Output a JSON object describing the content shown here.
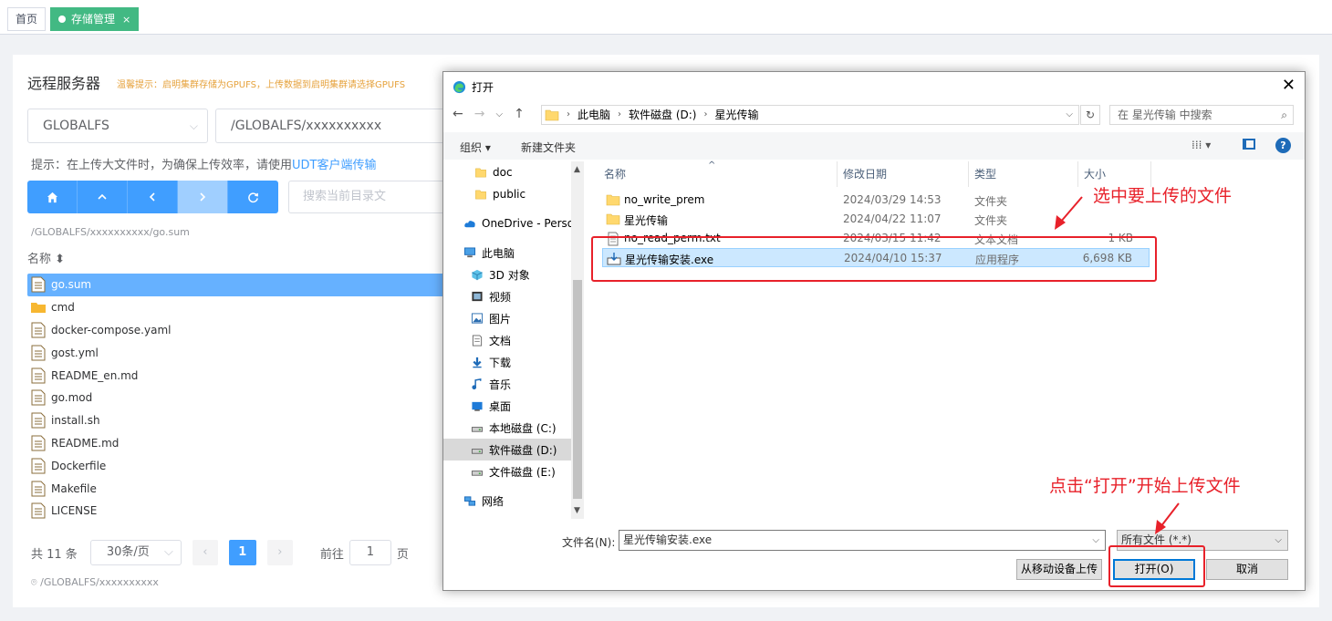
{
  "tabs": {
    "home": "首页",
    "storage": "存储管理",
    "close": "×"
  },
  "panel": {
    "title": "远程服务器",
    "warning": "温馨提示：启明集群存储为GPUFS，上传数据到启明集群请选择GPUFS",
    "storage_select": "GLOBALFS",
    "path_value": "/GLOBALFS/xxxxxxxxxx",
    "hint_prefix": "提示：在上传大文件时，为确保上传效率，请使用",
    "hint_link": "UDT客户端传输",
    "search_placeholder": "搜索当前目录文",
    "current_path": "/GLOBALFS/xxxxxxxxxx/go.sum",
    "column_name": "名称",
    "files": [
      {
        "name": "go.sum",
        "type": "file",
        "selected": true
      },
      {
        "name": "cmd",
        "type": "folder"
      },
      {
        "name": "docker-compose.yaml",
        "type": "file"
      },
      {
        "name": "gost.yml",
        "type": "file"
      },
      {
        "name": "README_en.md",
        "type": "file"
      },
      {
        "name": "go.mod",
        "type": "file"
      },
      {
        "name": "install.sh",
        "type": "file"
      },
      {
        "name": "README.md",
        "type": "file"
      },
      {
        "name": "Dockerfile",
        "type": "file"
      },
      {
        "name": "Makefile",
        "type": "file"
      },
      {
        "name": "LICENSE",
        "type": "file"
      }
    ],
    "pager": {
      "total": "共 11 条",
      "page_size": "30条/页",
      "current": "1",
      "goto_prefix": "前往",
      "goto_value": "1",
      "goto_suffix": "页"
    },
    "location": "/GLOBALFS/xxxxxxxxxx"
  },
  "dialog": {
    "title": "打开",
    "breadcrumb": [
      "此电脑",
      "软件磁盘 (D:)",
      "星光传输"
    ],
    "search_placeholder": "在 星光传输 中搜索",
    "organize": "组织 ▾",
    "new_folder": "新建文件夹",
    "view_icon": "⁞⁞⁞ ▾",
    "help": "?",
    "tree": [
      {
        "label": "doc",
        "icon": "folder-icon"
      },
      {
        "label": "public",
        "icon": "folder-icon"
      },
      {
        "label": "OneDrive - Perso",
        "icon": "cloud-icon"
      },
      {
        "label": "此电脑",
        "icon": "computer-icon"
      },
      {
        "label": "3D 对象",
        "icon": "cube-icon"
      },
      {
        "label": "视频",
        "icon": "video-icon"
      },
      {
        "label": "图片",
        "icon": "picture-icon"
      },
      {
        "label": "文档",
        "icon": "document-icon"
      },
      {
        "label": "下载",
        "icon": "download-icon"
      },
      {
        "label": "音乐",
        "icon": "music-icon"
      },
      {
        "label": "桌面",
        "icon": "desktop-icon"
      },
      {
        "label": "本地磁盘 (C:)",
        "icon": "drive-icon"
      },
      {
        "label": "软件磁盘 (D:)",
        "icon": "drive-icon",
        "selected": true
      },
      {
        "label": "文件磁盘 (E:)",
        "icon": "drive-icon"
      },
      {
        "label": "网络",
        "icon": "network-icon"
      }
    ],
    "columns": {
      "name": "名称",
      "date": "修改日期",
      "type": "类型",
      "size": "大小"
    },
    "files": [
      {
        "name": "no_write_prem",
        "date": "2024/03/29 14:53",
        "type": "文件夹",
        "size": "",
        "icon": "folder-icon"
      },
      {
        "name": "星光传输",
        "date": "2024/04/22 11:07",
        "type": "文件夹",
        "size": "",
        "icon": "folder-icon"
      },
      {
        "name": "no_read_perm.txt",
        "date": "2024/03/15 11:42",
        "type": "文本文档",
        "size": "1 KB",
        "icon": "text-file-icon"
      },
      {
        "name": "星光传输安装.exe",
        "date": "2024/04/10 15:37",
        "type": "应用程序",
        "size": "6,698 KB",
        "icon": "installer-icon",
        "selected": true
      }
    ],
    "filename_label": "文件名(N):",
    "filename_value": "星光传输安装.exe",
    "filetype": "所有文件 (*.*)",
    "btn_mobile": "从移动设备上传",
    "btn_open": "打开(O)",
    "btn_cancel": "取消"
  },
  "annotations": {
    "select_file": "选中要上传的文件",
    "click_open": "点击“打开”开始上传文件"
  },
  "colors": {
    "accent": "#409eff",
    "tab_active": "#42b983",
    "annotation": "#e8212a",
    "warning": "#e6a23c"
  }
}
